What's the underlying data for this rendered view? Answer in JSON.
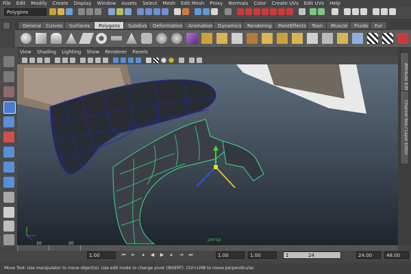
{
  "menubar": {
    "items": [
      "File",
      "Edit",
      "Modify",
      "Create",
      "Display",
      "Window",
      "Assets",
      "Select",
      "Mesh",
      "Edit Mesh",
      "Proxy",
      "Normals",
      "Color",
      "Create UVs",
      "Edit UVs",
      "Help"
    ]
  },
  "status_line": {
    "mode": "Polygons"
  },
  "shelf": {
    "tabs": [
      "General",
      "Curves",
      "Surfaces",
      "Polygons",
      "Subdivs",
      "Deformation",
      "Animation",
      "Dynamics",
      "Rendering",
      "PaintEffects",
      "Toon",
      "Muscle",
      "Fluids",
      "Fur"
    ],
    "active_tab": "Polygons"
  },
  "viewport": {
    "menu": [
      "View",
      "Shading",
      "Lighting",
      "Show",
      "Renderer",
      "Panels"
    ],
    "camera_label": "persp"
  },
  "right_panel": {
    "tabs": [
      "Attribute Editor",
      "Channel Box / Layer Editor"
    ]
  },
  "time_slider": {
    "tick_labels": [
      "10",
      "20"
    ],
    "current_frame": "1.00"
  },
  "range_slider": {
    "start_time": "1.00",
    "playback_start": "1.00",
    "range_start": "1",
    "range_end": "24",
    "playback_end": "24.00",
    "end_time": "48.00"
  },
  "help_line": {
    "text": "Move Tool: Use manipulator to move object(s). Use edit mode to change pivot (INSERT).  Ctrl+LMB to move perpendicular."
  },
  "colors": {
    "ui_background": "#444444",
    "active_tab": "#d7d7d7",
    "wireframe_selected": "#39e08a",
    "wireframe_unselected": "#1c2aa8",
    "viewport_top": "#5f7080",
    "viewport_bottom": "#1f252d"
  }
}
